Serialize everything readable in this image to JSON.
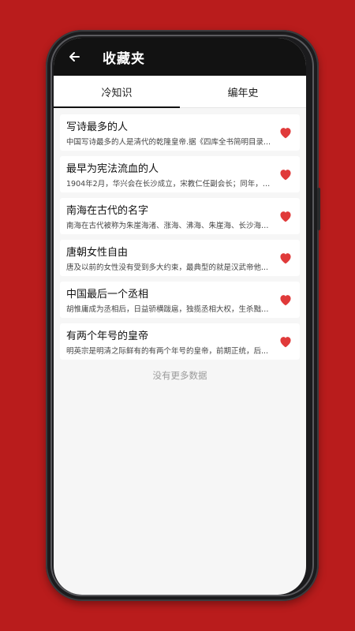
{
  "header": {
    "title": "收藏夹",
    "back_icon": "arrow-left-icon"
  },
  "tabs": [
    {
      "label": "冷知识",
      "active": true
    },
    {
      "label": "编年史",
      "active": false
    }
  ],
  "items": [
    {
      "title": "写诗最多的人",
      "desc": "中国写诗最多的人是清代的乾隆皇帝.据《四库全书简明目录..."
    },
    {
      "title": "最早为宪法流血的人",
      "desc": "1904年2月，华兴会在长沙成立，宋教仁任副会长；同年，因..."
    },
    {
      "title": "南海在古代的名字",
      "desc": "南海在古代被称为朱崖海渚、涨海、沸海、朱崖海、长沙海、..."
    },
    {
      "title": "唐朝女性自由",
      "desc": "唐及以前的女性没有受到多大约束，最典型的就是汉武帝他..."
    },
    {
      "title": "中国最后一个丞相",
      "desc": "胡惟庸成为丞相后，日益骄横跋扈，独揽丞相大权，生杀黜陟..."
    },
    {
      "title": "有两个年号的皇帝",
      "desc": "明英宗是明清之际鲜有的有两个年号的皇帝，前期正统，后..."
    }
  ],
  "footer_text": "没有更多数据",
  "colors": {
    "background": "#b91c1c",
    "heart": "#e03a3a",
    "appbar": "#121212"
  },
  "icons": {
    "favorite": "heart-icon"
  }
}
